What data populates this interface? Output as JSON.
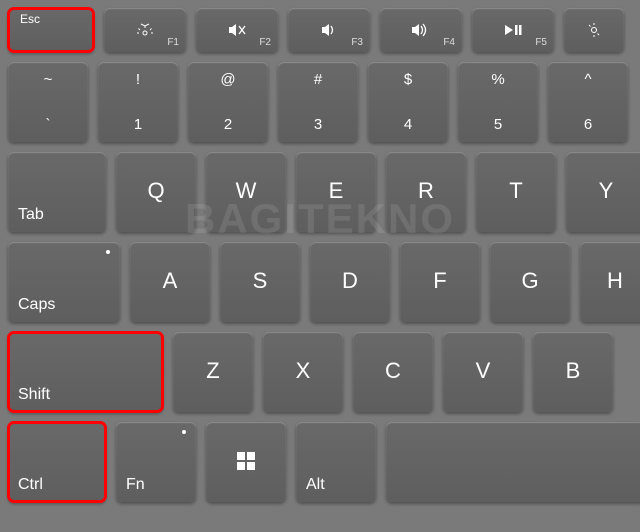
{
  "watermark": "BAGITEKNO",
  "fn_row": {
    "esc": "Esc",
    "keys": [
      {
        "icon": "brightness-down",
        "sub": "F1"
      },
      {
        "icon": "mute",
        "sub": "F2"
      },
      {
        "icon": "volume-down",
        "sub": "F3"
      },
      {
        "icon": "volume-up",
        "sub": "F4"
      },
      {
        "icon": "play-pause",
        "sub": "F5"
      },
      {
        "icon": "brightness-up",
        "sub": ""
      }
    ]
  },
  "num_row": [
    {
      "top": "~",
      "bot": "`"
    },
    {
      "top": "!",
      "bot": "1"
    },
    {
      "top": "@",
      "bot": "2"
    },
    {
      "top": "#",
      "bot": "3"
    },
    {
      "top": "$",
      "bot": "4"
    },
    {
      "top": "%",
      "bot": "5"
    },
    {
      "top": "^",
      "bot": "6"
    }
  ],
  "tab_row": {
    "tab": "Tab",
    "letters": [
      "Q",
      "W",
      "E",
      "R",
      "T",
      "Y"
    ]
  },
  "caps_row": {
    "caps": "Caps",
    "letters": [
      "A",
      "S",
      "D",
      "F",
      "G",
      "H"
    ]
  },
  "shift_row": {
    "shift": "Shift",
    "letters": [
      "Z",
      "X",
      "C",
      "V",
      "B"
    ]
  },
  "ctrl_row": {
    "ctrl": "Ctrl",
    "fn": "Fn",
    "alt": "Alt",
    "win": "windows"
  },
  "highlights": [
    "esc",
    "shift",
    "ctrl"
  ]
}
